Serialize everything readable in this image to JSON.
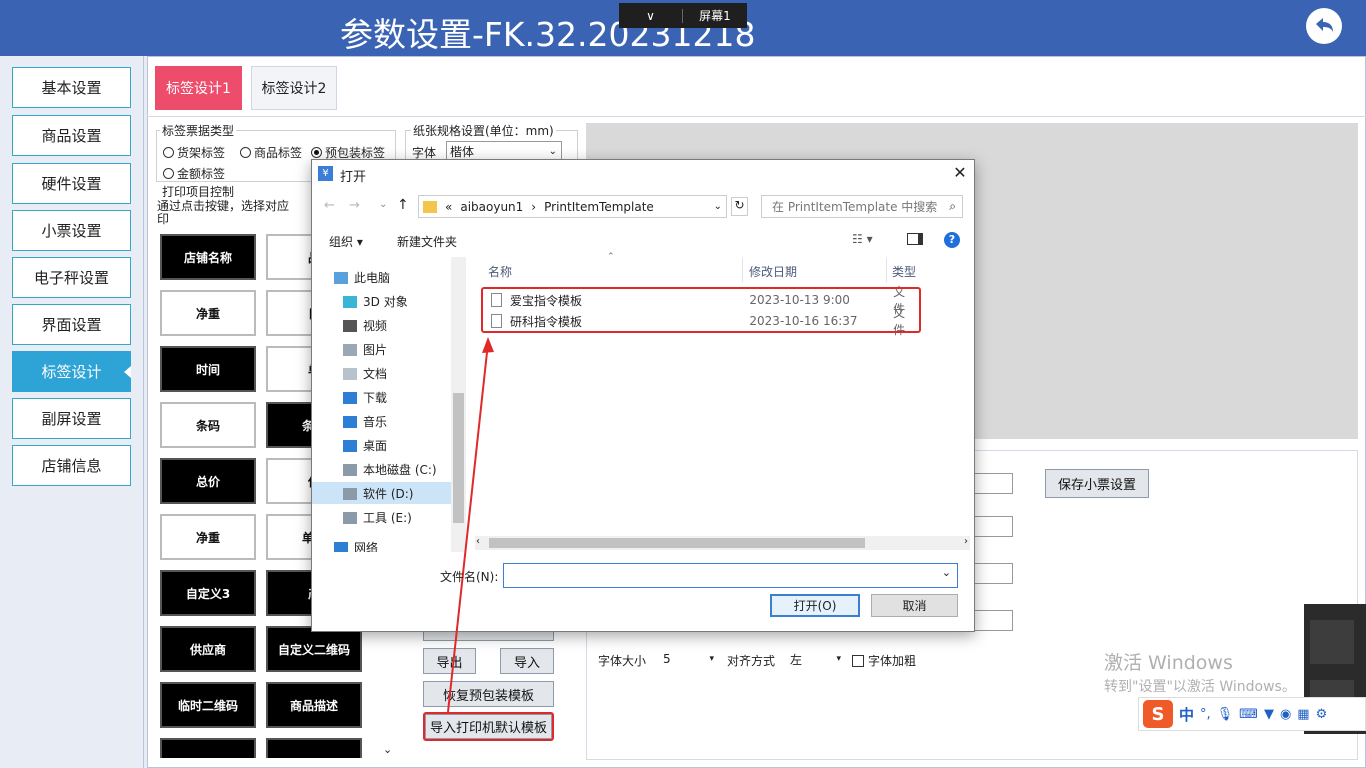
{
  "header": {
    "title": "参数设置-FK.32.20231218",
    "screen_label": "屏幕1",
    "screen_chevron": "∨"
  },
  "nav": {
    "items": [
      {
        "label": "基本设置"
      },
      {
        "label": "商品设置"
      },
      {
        "label": "硬件设置"
      },
      {
        "label": "小票设置"
      },
      {
        "label": "电子秤设置"
      },
      {
        "label": "界面设置"
      },
      {
        "label": "标签设计",
        "active": true
      },
      {
        "label": "副屏设置"
      },
      {
        "label": "店铺信息"
      }
    ]
  },
  "tabs": [
    {
      "label": "标签设计1",
      "active": true
    },
    {
      "label": "标签设计2"
    }
  ],
  "label_type": {
    "title": "标签票据类型",
    "options": [
      {
        "label": "货架标签",
        "checked": false
      },
      {
        "label": "商品标签",
        "checked": false
      },
      {
        "label": "预包装标签",
        "checked": true
      },
      {
        "label": "金额标签",
        "checked": false
      }
    ]
  },
  "paper": {
    "title": "纸张规格设置(单位：mm)",
    "font_label": "字体",
    "font_value": "楷体"
  },
  "print_items": {
    "title": "打印项目控制",
    "hint": "通过点击按键，选择对应",
    "hint2": "印",
    "items": [
      {
        "label": "店铺名称",
        "style": "dark"
      },
      {
        "label": "品",
        "style": "light"
      },
      {
        "label": "净重",
        "style": "light"
      },
      {
        "label": "日",
        "style": "light"
      },
      {
        "label": "时间",
        "style": "dark"
      },
      {
        "label": "单",
        "style": "light"
      },
      {
        "label": "条码",
        "style": "light"
      },
      {
        "label": "条码",
        "style": "dark"
      },
      {
        "label": "总价",
        "style": "dark"
      },
      {
        "label": "保",
        "style": "light"
      },
      {
        "label": "净重",
        "style": "light"
      },
      {
        "label": "单价",
        "style": "light"
      },
      {
        "label": "自定义3",
        "style": "dark"
      },
      {
        "label": "产",
        "style": "dark"
      },
      {
        "label": "供应商",
        "style": "dark"
      },
      {
        "label": "自定义二维码",
        "style": "dark"
      },
      {
        "label": "临时二维码",
        "style": "dark"
      },
      {
        "label": "商品描述",
        "style": "dark"
      }
    ]
  },
  "buttons": {
    "export": "导出",
    "import": "导入",
    "restore": "恢复预包装模板",
    "import_default": "导入打印机默认模板",
    "save_ticket": "保存小票设置"
  },
  "font_settings": {
    "size_label": "字体大小",
    "size_value": "5",
    "align_label": "对齐方式",
    "align_value": "左",
    "bold_label": "字体加粗"
  },
  "watermark": {
    "line1": "激活 Windows",
    "line2": "转到\"设置\"以激活 Windows。"
  },
  "ime": {
    "mode": "中"
  },
  "dialog": {
    "title": "打开",
    "path": [
      "«",
      "aibaoyun1",
      "›",
      "PrintItemTemplate"
    ],
    "search_placeholder": "在 PrintItemTemplate 中搜索",
    "organize": "组织 ▾",
    "new_folder": "新建文件夹",
    "tree": [
      {
        "label": "此电脑",
        "icon": "computer-icon"
      },
      {
        "label": "3D 对象",
        "icon": "cube-icon"
      },
      {
        "label": "视频",
        "icon": "video-icon"
      },
      {
        "label": "图片",
        "icon": "picture-icon"
      },
      {
        "label": "文档",
        "icon": "document-icon"
      },
      {
        "label": "下载",
        "icon": "download-icon"
      },
      {
        "label": "音乐",
        "icon": "music-icon"
      },
      {
        "label": "桌面",
        "icon": "desktop-icon"
      },
      {
        "label": "本地磁盘 (C:)",
        "icon": "drive-icon"
      },
      {
        "label": "软件 (D:)",
        "icon": "drive-icon",
        "selected": true
      },
      {
        "label": "工具 (E:)",
        "icon": "drive-icon"
      },
      {
        "label": "网络",
        "icon": "network-icon"
      }
    ],
    "columns": [
      "名称",
      "修改日期",
      "类型"
    ],
    "files": [
      {
        "name": "爱宝指令模板",
        "date": "2023-10-13 9:00",
        "type": "文件"
      },
      {
        "name": "研科指令模板",
        "date": "2023-10-16 16:37",
        "type": "文件"
      }
    ],
    "filename_label": "文件名(N):",
    "filename_value": "",
    "open_label": "打开(O)",
    "cancel_label": "取消"
  },
  "colors": {
    "header": "#3a63b4",
    "active_tab": "#ee4c6b",
    "active_nav": "#2ea3d6",
    "highlight": "#e02a2a"
  }
}
